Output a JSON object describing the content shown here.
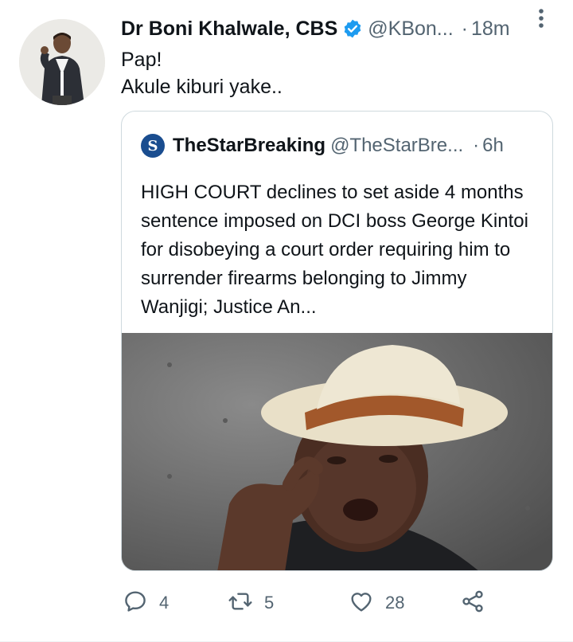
{
  "tweet": {
    "author_name": "Dr Boni Khalwale, CBS",
    "handle": "@KBon...",
    "separator": "·",
    "time": "18m",
    "text_line1": "Pap!",
    "text_line2": "Akule kiburi yake.."
  },
  "quoted_tweet": {
    "logo_text": "S",
    "author_name": "TheStarBreaking",
    "handle": "@TheStarBre...",
    "separator": "·",
    "time": "6h",
    "text": "HIGH COURT declines to set aside 4 months sentence imposed on DCI boss George Kintoi for disobeying a court order requiring him to surrender firearms belonging to Jimmy Wanjigi; Justice An..."
  },
  "actions": {
    "reply_count": "4",
    "retweet_count": "5",
    "like_count": "28"
  },
  "icons": {
    "verified": "verified-badge-icon",
    "more": "more-vertical-icon",
    "reply": "reply-icon",
    "retweet": "retweet-icon",
    "like": "heart-icon",
    "share": "share-icon"
  },
  "colors": {
    "verified_blue": "#1d9bf0",
    "text_primary": "#0f1419",
    "text_secondary": "#536471",
    "border": "#cfd9de"
  }
}
